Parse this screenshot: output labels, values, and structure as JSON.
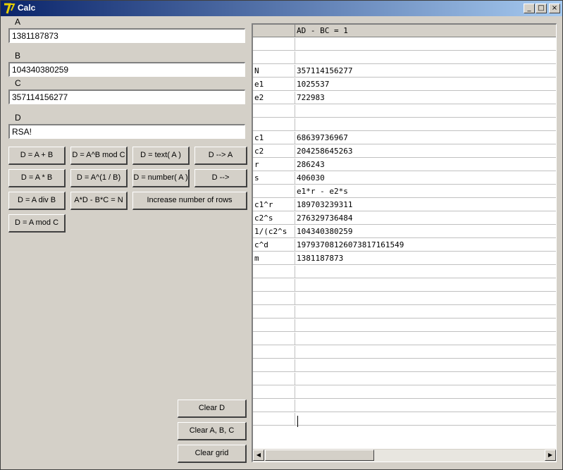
{
  "window": {
    "title": "Calc",
    "logo": "calc-logo-icon"
  },
  "titlebar_buttons": {
    "minimize": "minimize-icon",
    "maximize": "maximize-icon",
    "close": "close-icon"
  },
  "fields": {
    "a": {
      "label": "A",
      "value": "1381187873"
    },
    "b": {
      "label": "B",
      "value": "104340380259"
    },
    "c": {
      "label": "C",
      "value": "357114156277"
    },
    "d": {
      "label": "D",
      "value": "RSA!"
    }
  },
  "buttons": {
    "d_a_plus_b": "D = A + B",
    "d_a_pow_b_mod_c": "D = A^B mod C",
    "d_text_a": "D = text( A )",
    "d_to_a": "D --> A",
    "d_a_times_b": "D = A * B",
    "d_a_root_b": "D = A^(1 / B)",
    "d_number_a": "D = number( A )",
    "d_to": "D -->",
    "d_a_div_b": "D = A div B",
    "ad_bc_n": "A*D - B*C = N",
    "increase_rows": "Increase number of rows",
    "d_a_mod_c": "D = A mod C",
    "clear_d": "Clear D",
    "clear_abc": "Clear A, B, C",
    "clear_grid": "Clear grid"
  },
  "grid": {
    "header": [
      "",
      "AD - BC = 1"
    ],
    "rows": [
      [
        "",
        ""
      ],
      [
        "",
        ""
      ],
      [
        "N",
        "357114156277"
      ],
      [
        "e1",
        "1025537"
      ],
      [
        "e2",
        "722983"
      ],
      [
        "",
        ""
      ],
      [
        "",
        ""
      ],
      [
        "c1",
        "68639736967"
      ],
      [
        "c2",
        "204258645263"
      ],
      [
        "r",
        "286243"
      ],
      [
        "s",
        "406030"
      ],
      [
        "",
        "e1*r - e2*s"
      ],
      [
        "c1^r",
        "189703239311"
      ],
      [
        "c2^s",
        "276329736484"
      ],
      [
        "1/(c2^s",
        "104340380259"
      ],
      [
        "c^d",
        "1979370812607381716154​9"
      ],
      [
        "m",
        "1381187873"
      ],
      [
        "",
        ""
      ],
      [
        "",
        ""
      ],
      [
        "",
        ""
      ],
      [
        "",
        ""
      ],
      [
        "",
        ""
      ],
      [
        "",
        ""
      ],
      [
        "",
        ""
      ],
      [
        "",
        ""
      ],
      [
        "",
        ""
      ],
      [
        "",
        ""
      ],
      [
        "",
        ""
      ],
      [
        "",
        ""
      ]
    ]
  },
  "scrollbar": {
    "left": "scroll-left-icon",
    "right": "scroll-right-icon"
  }
}
